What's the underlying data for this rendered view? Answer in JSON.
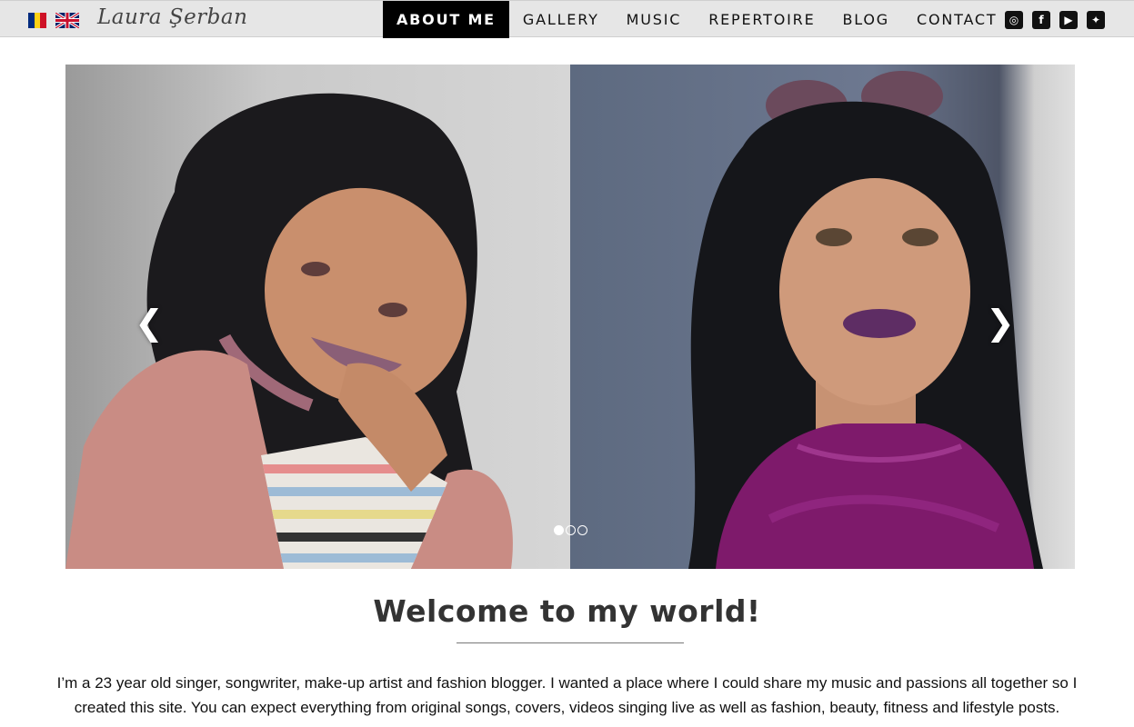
{
  "header": {
    "brand": "Laura Şerban",
    "flags": [
      {
        "name": "romanian-flag",
        "colors": [
          "#002B7F",
          "#FCD116",
          "#CE1126"
        ]
      },
      {
        "name": "english-flag"
      }
    ],
    "nav": [
      {
        "label": "ABOUT ME",
        "active": true
      },
      {
        "label": "GALLERY",
        "active": false
      },
      {
        "label": "MUSIC",
        "active": false
      },
      {
        "label": "REPERTOIRE",
        "active": false
      },
      {
        "label": "BLOG",
        "active": false
      },
      {
        "label": "CONTACT",
        "active": false
      }
    ],
    "social": [
      {
        "icon": "instagram-icon",
        "glyph": "◎"
      },
      {
        "icon": "facebook-icon",
        "glyph": "f"
      },
      {
        "icon": "youtube-icon",
        "glyph": "▶"
      },
      {
        "icon": "twitter-icon",
        "glyph": "✦"
      }
    ]
  },
  "carousel": {
    "prev_glyph": "❮",
    "next_glyph": "❯",
    "dots": [
      true,
      false,
      false
    ]
  },
  "content": {
    "heading": "Welcome to my world!",
    "intro": "I’m a 23 year old singer, songwriter, make-up artist and fashion blogger. I wanted a place where I could share my music and passions all together so I created this site. You can expect everything from original songs, covers, videos singing live as well as fashion, beauty, fitness and lifestyle posts."
  },
  "colors": {
    "nav_bg": "#e6e6e6",
    "nav_active_bg": "#000000",
    "text": "#111111"
  }
}
